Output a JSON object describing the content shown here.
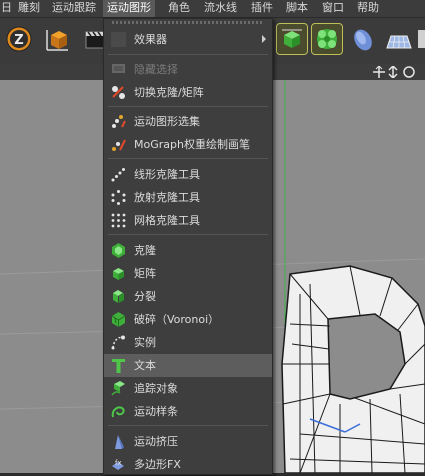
{
  "menubar": {
    "items": [
      "日",
      "雕刻",
      "运动跟踪",
      "运动图形",
      "角色",
      "流水线",
      "插件",
      "脚本",
      "窗口",
      "帮助"
    ]
  },
  "menu": {
    "items": [
      {
        "label": "效果器",
        "icon": "effector-submenu-icon"
      },
      {
        "label": "隐藏选择",
        "icon": "hide-selection-icon"
      },
      {
        "label": "切换克隆/矩阵",
        "icon": "toggle-clone-matrix-icon"
      },
      {
        "label": "运动图形选集",
        "icon": "mograph-selection-icon"
      },
      {
        "label": "MoGraph权重绘制画笔",
        "icon": "weight-paint-brush-icon"
      },
      {
        "label": "线形克隆工具",
        "icon": "linear-clone-icon"
      },
      {
        "label": "放射克隆工具",
        "icon": "radial-clone-icon"
      },
      {
        "label": "网格克隆工具",
        "icon": "grid-clone-icon"
      },
      {
        "label": "克隆",
        "icon": "cloner-icon"
      },
      {
        "label": "矩阵",
        "icon": "matrix-icon"
      },
      {
        "label": "分裂",
        "icon": "fracture-icon"
      },
      {
        "label": "破碎（Voronoi）",
        "icon": "voronoi-fracture-icon"
      },
      {
        "label": "实例",
        "icon": "instance-icon"
      },
      {
        "label": "文本",
        "icon": "text-icon"
      },
      {
        "label": "追踪对象",
        "icon": "tracer-icon"
      },
      {
        "label": "运动样条",
        "icon": "mospline-icon"
      },
      {
        "label": "运动挤压",
        "icon": "moextrude-icon"
      },
      {
        "label": "多边形FX",
        "icon": "polyfx-icon"
      }
    ]
  },
  "colors": {
    "menu_bg": "#3e3e3e",
    "selected_bg": "#5d5d5d",
    "highlight_icon": "#4fc64a"
  }
}
